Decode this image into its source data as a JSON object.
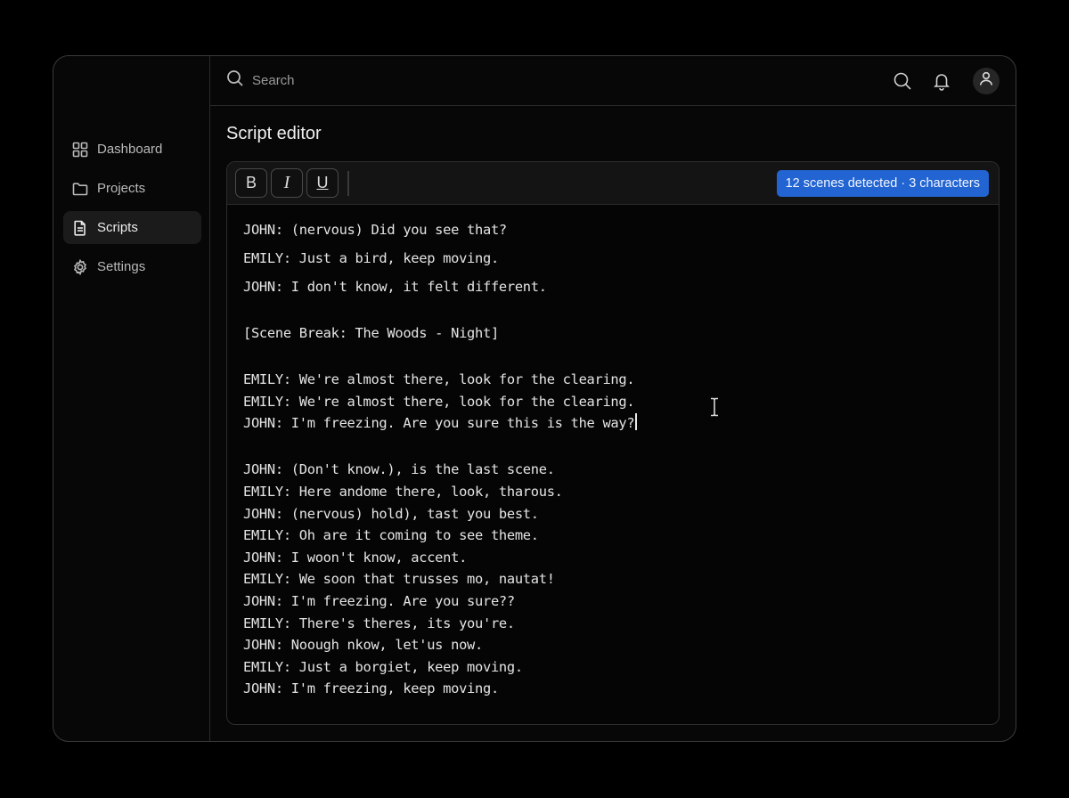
{
  "sidebar": {
    "items": [
      {
        "label": "Dashboard",
        "icon": "grid-icon",
        "active": false
      },
      {
        "label": "Projects",
        "icon": "folder-icon",
        "active": false
      },
      {
        "label": "Scripts",
        "icon": "document-icon",
        "active": true
      },
      {
        "label": "Settings",
        "icon": "gear-icon",
        "active": false
      }
    ]
  },
  "topbar": {
    "search_placeholder": "Search",
    "icons": [
      "search-icon",
      "bell-icon",
      "user-icon"
    ]
  },
  "page": {
    "title": "Script editor"
  },
  "editor": {
    "toolbar": {
      "bold_label": "B",
      "italic_label": "I",
      "underline_label": "U",
      "badge": "12 scenes detected · 3 characters"
    },
    "lines": [
      "JOHN: (nervous) Did you see that?",
      "EMILY: Just a bird, keep moving.",
      "JOHN: I don't know, it felt different.",
      "[Scene Break: The Woods - Night]",
      "EMILY: We're almost there, look for the clearing.",
      "EMILY: We're almost there, look for the clearing.",
      "JOHN: I'm freezing. Are you sure this is the way?",
      "JOHN: (Don't know.), is the last scene.",
      "EMILY: Here andome there, look, tharous.",
      "JOHN: (nervous) hold), tast you best.",
      "EMILY: Oh are it coming to see theme.",
      "JOHN: I woon't know, accent.",
      "EMILY: We soon that trusses mo, nautat!",
      "JOHN: I'm freezing. Are you sure??",
      "EMILY: There's theres, its you're.",
      "JOHN: Noough nkow, let'us now.",
      "EMILY: Just a borgiet, keep moving.",
      "JOHN: I'm freezing, keep moving."
    ]
  },
  "colors": {
    "accent": "#2264d1",
    "background": "#000000",
    "panel": "#070707"
  }
}
